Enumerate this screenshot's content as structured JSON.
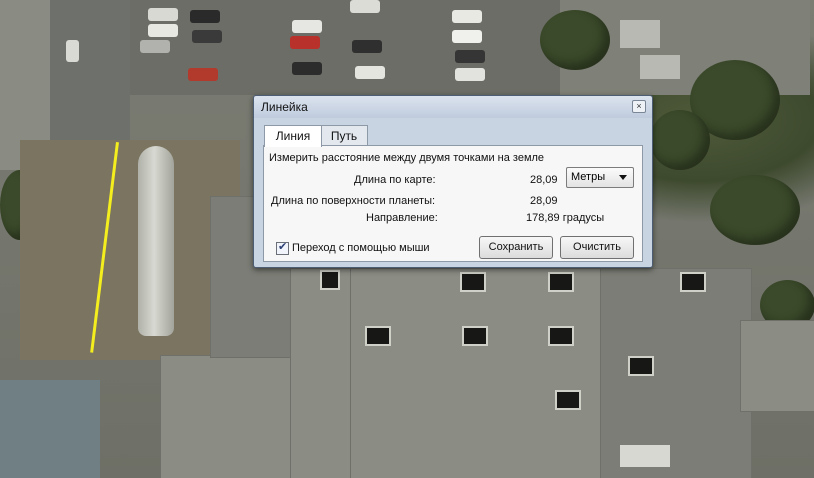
{
  "dialog": {
    "title": "Линейка",
    "close_glyph": "×",
    "tabs": [
      {
        "label": "Линия",
        "active": true
      },
      {
        "label": "Путь",
        "active": false
      }
    ],
    "instruction": "Измерить расстояние между двумя точками на земле",
    "map_length": {
      "label": "Длина по карте:",
      "value": "28,09"
    },
    "units": {
      "selected": "Метры"
    },
    "ground_length": {
      "label": "Длина по поверхности планеты:",
      "value": "28,09"
    },
    "heading": {
      "label": "Направление:",
      "value": "178,89 градусы"
    },
    "mouse_navigation": {
      "label": "Переход с помощью мыши",
      "checked": true
    },
    "save_label": "Сохранить",
    "clear_label": "Очистить"
  },
  "colors": {
    "ruler_line": "#f4ee1e",
    "dialog_frame": "#c9d4e3"
  }
}
